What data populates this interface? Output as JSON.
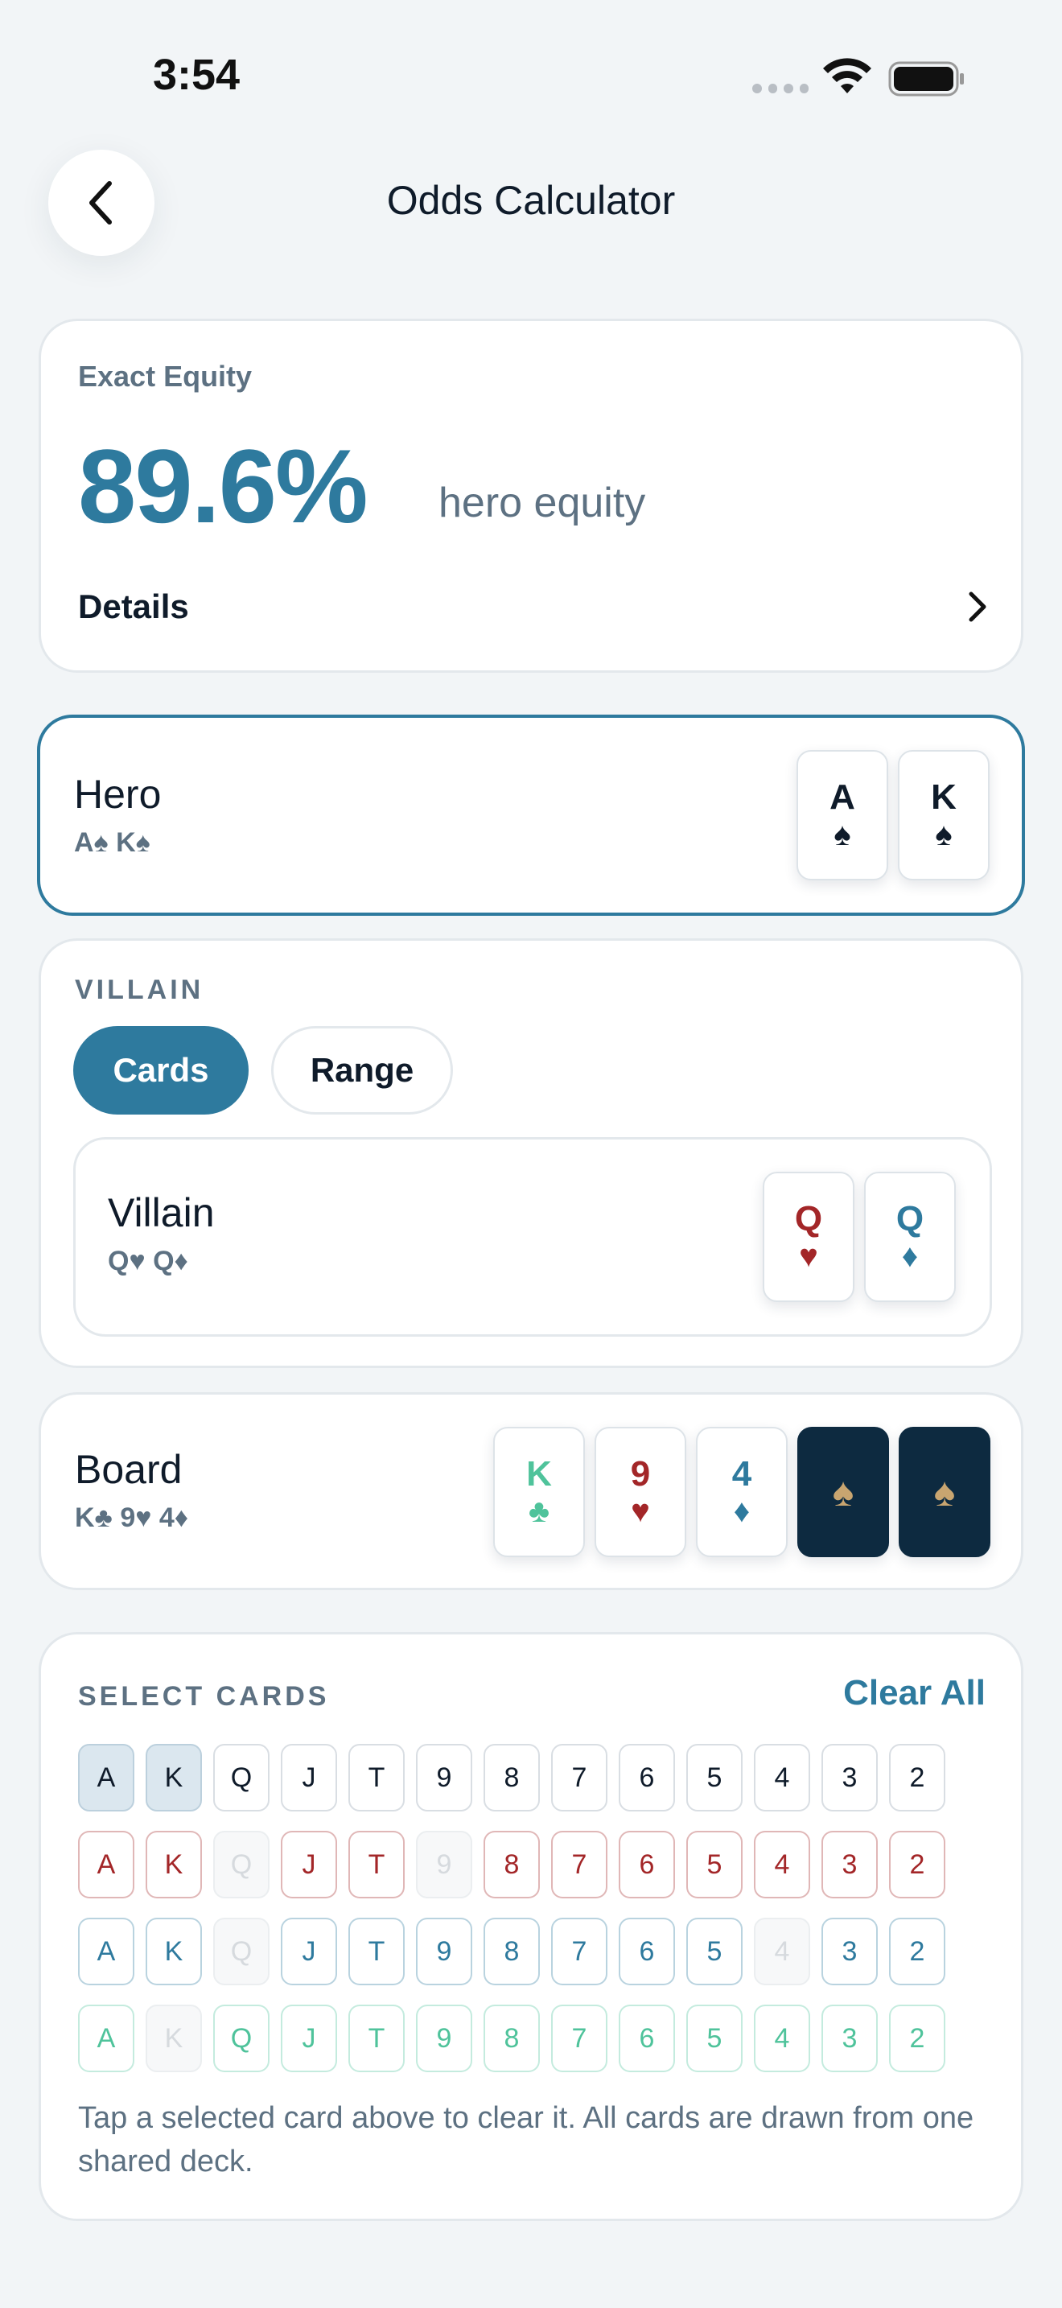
{
  "status": {
    "time": "3:54"
  },
  "header": {
    "title": "Odds Calculator"
  },
  "equity": {
    "label": "Exact Equity",
    "value": "89.6%",
    "suffix": "hero equity",
    "details_label": "Details"
  },
  "hero": {
    "name": "Hero",
    "cards_text": "A♠ K♠",
    "cards": [
      {
        "rank": "A",
        "suit": "♠",
        "color": "#0f1b2a"
      },
      {
        "rank": "K",
        "suit": "♠",
        "color": "#0f1b2a"
      }
    ]
  },
  "villain": {
    "section_label": "VILLAIN",
    "tabs": {
      "cards": "Cards",
      "range": "Range"
    },
    "name": "Villain",
    "cards_text": "Q♥ Q♦",
    "cards": [
      {
        "rank": "Q",
        "suit": "♥",
        "color": "#a32628"
      },
      {
        "rank": "Q",
        "suit": "♦",
        "color": "#2e7a9e"
      }
    ]
  },
  "board": {
    "name": "Board",
    "cards_text": "K♣ 9♥ 4♦",
    "cards": [
      {
        "rank": "K",
        "suit": "♣",
        "color": "#4fc39b"
      },
      {
        "rank": "9",
        "suit": "♥",
        "color": "#a32628"
      },
      {
        "rank": "4",
        "suit": "♦",
        "color": "#2e7a9e"
      }
    ],
    "empty_slot_suit": "♠"
  },
  "selector": {
    "section_label": "SELECT CARDS",
    "clear_label": "Clear All",
    "ranks": [
      "A",
      "K",
      "Q",
      "J",
      "T",
      "9",
      "8",
      "7",
      "6",
      "5",
      "4",
      "3",
      "2"
    ],
    "suit_colors": [
      "#0f1b2a",
      "#a32628",
      "#2e7a9e",
      "#4fc39b"
    ],
    "rows": [
      {
        "selected": [
          "A",
          "K"
        ],
        "used": []
      },
      {
        "selected": [],
        "used": [
          "Q",
          "9"
        ]
      },
      {
        "selected": [],
        "used": [
          "Q",
          "4"
        ]
      },
      {
        "selected": [],
        "used": [
          "K"
        ]
      }
    ],
    "hint": "Tap a selected card above to clear it. All cards are drawn from one shared deck."
  }
}
